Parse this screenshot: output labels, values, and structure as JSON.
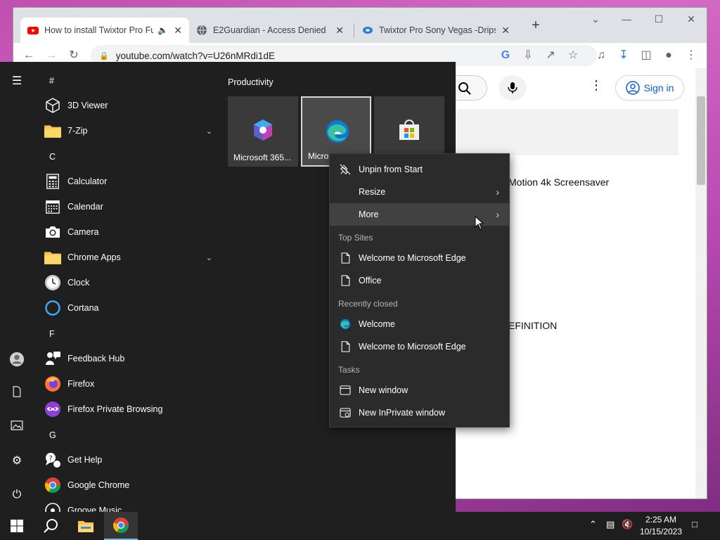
{
  "browser": {
    "tabs": [
      {
        "title": "How to install Twixtor Pro Fu",
        "active": true,
        "audio": true
      },
      {
        "title": "E2Guardian - Access Denied",
        "active": false
      },
      {
        "title": "Twixtor Pro Sony Vegas -Drips-",
        "active": false
      }
    ],
    "new_tab": "+",
    "url": "youtube.com/watch?v=U26nMRdi1dE"
  },
  "youtube": {
    "sign_in": "Sign in",
    "video_title_fragment": "Motion 4k Screensaver",
    "text_fragment": "EFINITION"
  },
  "start_menu": {
    "letters": {
      "hash": "#",
      "c": "C",
      "f": "F",
      "g": "G"
    },
    "apps": [
      {
        "name": "3D Viewer",
        "icon": "cube-icon"
      },
      {
        "name": "7-Zip",
        "icon": "folder-icon",
        "expandable": true
      },
      {
        "name": "Calculator",
        "icon": "calculator-icon"
      },
      {
        "name": "Calendar",
        "icon": "calendar-icon"
      },
      {
        "name": "Camera",
        "icon": "camera-icon"
      },
      {
        "name": "Chrome Apps",
        "icon": "folder-icon",
        "expandable": true
      },
      {
        "name": "Clock",
        "icon": "clock-icon"
      },
      {
        "name": "Cortana",
        "icon": "cortana-icon"
      },
      {
        "name": "Feedback Hub",
        "icon": "feedback-icon"
      },
      {
        "name": "Firefox",
        "icon": "firefox-icon"
      },
      {
        "name": "Firefox Private Browsing",
        "icon": "firefox-private-icon"
      },
      {
        "name": "Get Help",
        "icon": "help-icon"
      },
      {
        "name": "Google Chrome",
        "icon": "chrome-icon"
      },
      {
        "name": "Groove Music",
        "icon": "music-icon"
      }
    ],
    "group_title": "Productivity",
    "tiles": [
      {
        "label": "Microsoft 365...",
        "icon": "m365-icon"
      },
      {
        "label": "Micro",
        "icon": "edge-icon",
        "selected": true
      },
      {
        "label": "",
        "icon": "store-icon"
      }
    ]
  },
  "context_menu": {
    "items": [
      {
        "label": "Unpin from Start",
        "icon": "unpin-icon"
      },
      {
        "label": "Resize",
        "submenu": true
      },
      {
        "label": "More",
        "submenu": true,
        "hover": true
      }
    ],
    "sections": [
      {
        "title": "Top Sites",
        "items": [
          {
            "label": "Welcome to Microsoft Edge",
            "icon": "page-icon"
          },
          {
            "label": "Office",
            "icon": "page-icon"
          }
        ]
      },
      {
        "title": "Recently closed",
        "items": [
          {
            "label": "Welcome",
            "icon": "edge-icon"
          },
          {
            "label": "Welcome to Microsoft Edge",
            "icon": "page-icon"
          }
        ]
      },
      {
        "title": "Tasks",
        "items": [
          {
            "label": "New window",
            "icon": "window-icon"
          },
          {
            "label": "New InPrivate window",
            "icon": "inprivate-icon"
          }
        ]
      }
    ]
  },
  "taskbar": {
    "time": "2:25 AM",
    "date": "10/15/2023"
  }
}
